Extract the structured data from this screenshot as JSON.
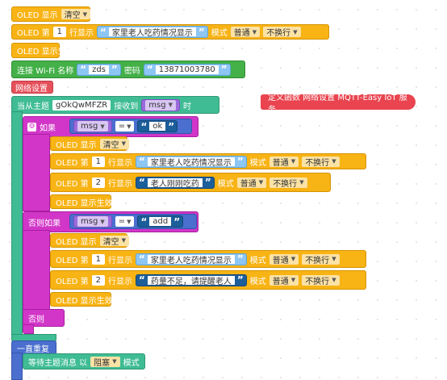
{
  "blocks": {
    "oled_display": "OLED 显示",
    "clear": "清空",
    "oled_line": "OLED 第",
    "line_display": "行显示",
    "mode": "模式",
    "normal": "普通",
    "no_wrap": "不换行",
    "oled_commit": "OLED 显示生效",
    "wifi_connect": "连接 Wi-Fi 名称",
    "wifi_password": "密码",
    "net_settings": "网络设置",
    "subscribe_prefix": "当从主题",
    "subscribe_recv": "接收到",
    "subscribe_suffix": "时",
    "if": "如果",
    "else_if": "否则如果",
    "else": "否则",
    "forever": "一直重复",
    "wait_topic": "等待主题消息 以",
    "blocking": "阻塞",
    "wait_mode": "模式",
    "eq": "="
  },
  "values": {
    "line1": "1",
    "line2": "2",
    "msg_text_main": "家里老人吃药情况显示",
    "wifi_ssid": "zds",
    "wifi_pwd": "13871003780",
    "topic": "gOkQwMFZR",
    "var_msg": "msg",
    "cond1": "ok",
    "cond2": "add",
    "ok_line2": "老人刚刚吃药",
    "add_line2": "药量不足，请提醒老人"
  },
  "comment": {
    "text": "定义函数 网络设置 MQTT-Easy IoT 服务..."
  },
  "colors": {
    "oled": "#f8b314",
    "wifi": "#43b048",
    "function": "#e5515b",
    "event": "#3fbc94",
    "control": "#d236c8",
    "loop": "#4a6fcf",
    "string": "#8ec6f3",
    "variable": "#9b6bdb"
  }
}
